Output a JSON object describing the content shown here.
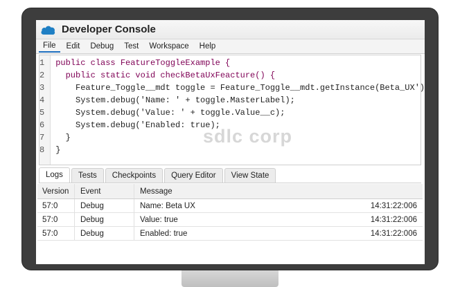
{
  "window": {
    "title": "Developer Console"
  },
  "menu": [
    "File",
    "Edit",
    "Debug",
    "Test",
    "Workspace",
    "Help"
  ],
  "editor": {
    "line_numbers": [
      "1",
      "2",
      "3",
      "4",
      "5",
      "6",
      "7",
      "8"
    ],
    "code_lines": [
      "public class FeatureToggleExample {",
      "  public static void checkBetaUxFeacture() {",
      "    Feature_Toggle__mdt toggle = Feature_Toggle__mdt.getInstance(Beta_UX');",
      "    System.debug('Name: ' + toggle.MasterLabel);",
      "    System.debug('Value: ' + toggle.Value__c);",
      "    System.debug('Enabled: true);",
      "  }",
      "}"
    ],
    "watermark": "sdlc corp"
  },
  "tabs": [
    "Logs",
    "Tests",
    "Checkpoints",
    "Query Editor",
    "View State"
  ],
  "log_table": {
    "headers": {
      "version": "Version",
      "event": "Event",
      "message": "Message"
    },
    "rows": [
      {
        "version": "57:0",
        "event": "Debug",
        "message": "Name: Beta UX",
        "time": "14:31:22:006"
      },
      {
        "version": "57:0",
        "event": "Debug",
        "message": "Value: true",
        "time": "14:31:22:006"
      },
      {
        "version": "57:0",
        "event": "Debug",
        "message": "Enabled: true",
        "time": "14:31:22:006"
      }
    ]
  },
  "colors": {
    "brand_cloud": "#1f7fc4",
    "monitor_bezel": "#3d3d3d"
  }
}
